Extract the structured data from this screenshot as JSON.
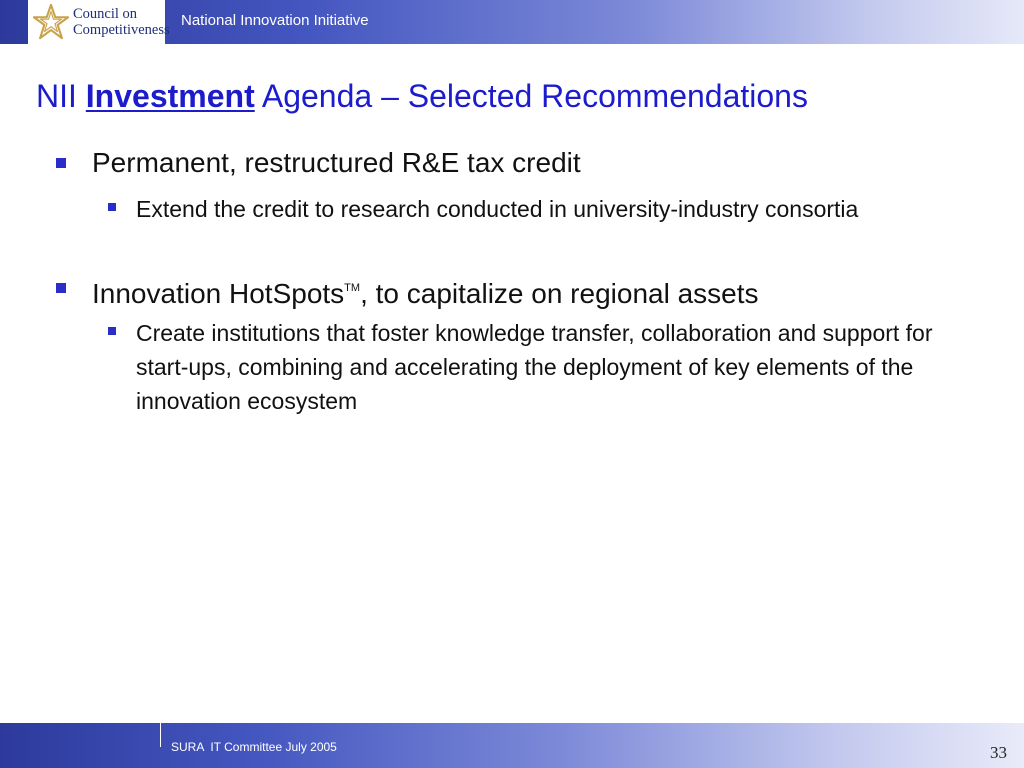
{
  "header": {
    "logo": {
      "line1": "Council on",
      "line2": "Competitiveness"
    },
    "title": "National Innovation Initiative"
  },
  "slide": {
    "title_prefix": "NII ",
    "title_emphasis": "Investment",
    "title_suffix": " Agenda – Selected Recommendations",
    "bullets": [
      {
        "text": "Permanent, restructured R&E tax credit",
        "sub": [
          "Extend the credit to research conducted in university-industry consortia"
        ]
      },
      {
        "text_before": "Innovation HotSpots",
        "trademark": "TM",
        "text_after": ", to capitalize on regional assets",
        "sub": [
          "Create institutions that foster knowledge transfer, collaboration and support for start-ups, combining and accelerating the deployment of key elements of the innovation ecosystem"
        ]
      }
    ]
  },
  "footer": {
    "text": "SURA  IT Committee July 2005",
    "page_number": "33"
  },
  "colors": {
    "header_dark": "#2d3a9c",
    "title_blue": "#1c1ccc",
    "bullet_marker": "#2a2ec8"
  },
  "icons": {
    "logo": "star-logo-icon",
    "bullet": "square-bullet-icon"
  }
}
